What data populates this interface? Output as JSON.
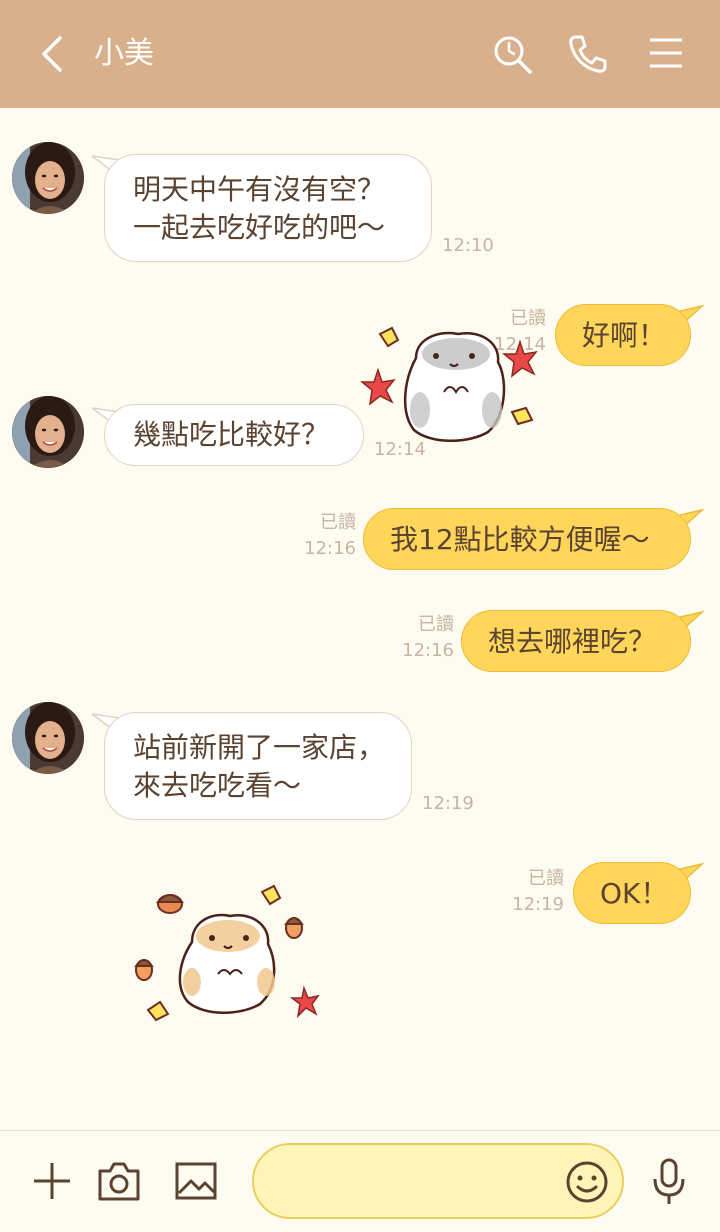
{
  "header": {
    "title": "小美",
    "bg": "#d8b08c",
    "icons": [
      "back-arrow-icon",
      "search-icon",
      "phone-icon",
      "menu-icon"
    ]
  },
  "messages": [
    {
      "side": "left",
      "text": "明天中午有沒有空？\n一起去吃好吃的吧～",
      "time": "12:10"
    },
    {
      "side": "right",
      "text": "好啊！",
      "read": "已讀",
      "time": "12:14"
    },
    {
      "side": "sticker",
      "name": "hamster-leaves-sticker"
    },
    {
      "side": "left",
      "text": "幾點吃比較好？",
      "time": "12:14"
    },
    {
      "side": "right",
      "text": "我12點比較方便喔～",
      "read": "已讀",
      "time": "12:16"
    },
    {
      "side": "right",
      "text": "想去哪裡吃？",
      "read": "已讀",
      "time": "12:16"
    },
    {
      "side": "left",
      "text": "站前新開了一家店，\n來去吃吃看～",
      "time": "12:19"
    },
    {
      "side": "right",
      "text": "OK！",
      "read": "已讀",
      "time": "12:19"
    },
    {
      "side": "sticker",
      "name": "hamster-acorn-sticker"
    }
  ],
  "footer": {
    "input_value": "",
    "icons": [
      "plus-icon",
      "camera-icon",
      "image-icon",
      "emoji-icon",
      "microphone-icon"
    ]
  },
  "colors": {
    "chat_bg": "#fefcf0",
    "my_bubble": "#ffd65a",
    "their_bubble": "#ffffff",
    "text": "#5a4330"
  }
}
